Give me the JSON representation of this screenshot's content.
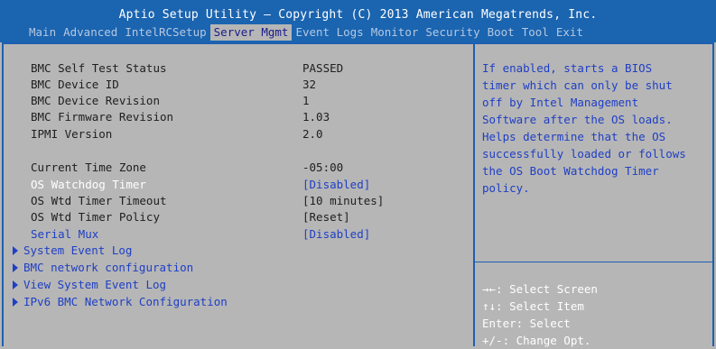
{
  "header": {
    "title": "Aptio Setup Utility – Copyright (C) 2013 American Megatrends, Inc.",
    "tabs": [
      "Main",
      "Advanced",
      "IntelRCSetup",
      "Server Mgmt",
      "Event Logs",
      "Monitor",
      "Security",
      "Boot",
      "Tool",
      "Exit"
    ],
    "active_tab": "Server Mgmt"
  },
  "info": [
    {
      "label": "BMC Self Test Status",
      "value": "PASSED"
    },
    {
      "label": "BMC Device ID",
      "value": "32"
    },
    {
      "label": "BMC Device Revision",
      "value": "1"
    },
    {
      "label": "BMC Firmware Revision",
      "value": "1.03"
    },
    {
      "label": "IPMI Version",
      "value": "2.0"
    }
  ],
  "settings": [
    {
      "label": "Current Time Zone",
      "value": "-05:00"
    },
    {
      "label": "OS Watchdog Timer",
      "value": "[Disabled]"
    },
    {
      "label": "OS Wtd Timer Timeout",
      "value": "[10 minutes]"
    },
    {
      "label": "OS Wtd Timer Policy",
      "value": "[Reset]"
    },
    {
      "label": "Serial Mux",
      "value": "[Disabled]"
    }
  ],
  "submenus": [
    "System Event Log",
    "BMC network configuration",
    "View System Event Log",
    "IPv6 BMC Network Configuration"
  ],
  "help_lines": [
    "If enabled, starts a BIOS",
    "timer which can only be shut",
    "off by Intel Management",
    "Software after the OS loads.",
    "Helps determine that the OS",
    "successfully loaded or follows",
    "the OS Boot Watchdog Timer",
    "policy."
  ],
  "key_help": [
    "→←: Select Screen",
    "↑↓: Select Item",
    "Enter: Select",
    "+/-: Change Opt."
  ],
  "colors": {
    "header_bg": "#1a64b0",
    "body_bg": "#b6b6b6",
    "highlight": "#ffffff",
    "accent_text": "#1f3fc4"
  }
}
